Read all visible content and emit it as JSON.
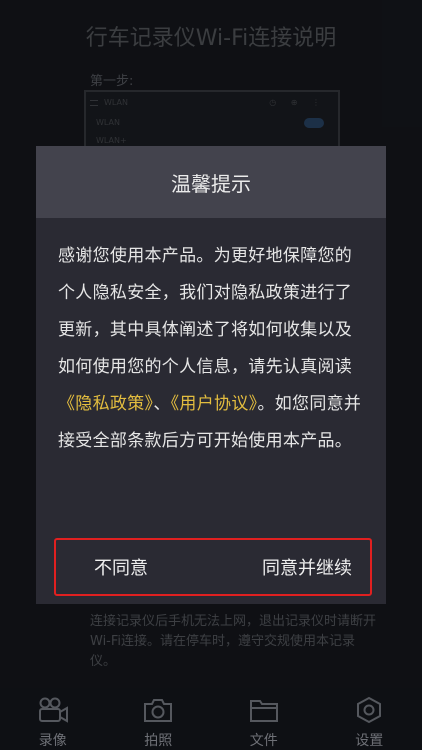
{
  "background": {
    "title": "行车记录仪Wi-Fi连接说明",
    "step_label": "第一步:",
    "screenshot": {
      "header_label": "WLAN",
      "row_wlan": "WLAN",
      "row_wlan_plus": "WLAN+",
      "tools": "◷ ⊕ ⋮"
    },
    "note": "连接记录仪后手机无法上网，退出记录仪时请断开Wi-Fi连接。请在停车时，遵守交规使用本记录仪。"
  },
  "dialog": {
    "title": "温馨提示",
    "body_part1": "感谢您使用本产品。为更好地保障您的个人隐私安全，我们对隐私政策进行了更新，其中具体阐述了将如何收集以及如何使用您的个人信息，请先认真阅读",
    "privacy_link": "《隐私政策》",
    "separator": "、",
    "agreement_link": "《用户协议》",
    "body_part2": "。如您同意并接受全部条款后方可开始使用本产品。",
    "disagree_label": "不同意",
    "agree_label": "同意并继续",
    "link_color": "#e3bd3f"
  },
  "tabbar": {
    "items": [
      {
        "label": "录像",
        "icon": "video-camera-icon"
      },
      {
        "label": "拍照",
        "icon": "camera-icon"
      },
      {
        "label": "文件",
        "icon": "folder-icon"
      },
      {
        "label": "设置",
        "icon": "gear-icon"
      }
    ]
  }
}
